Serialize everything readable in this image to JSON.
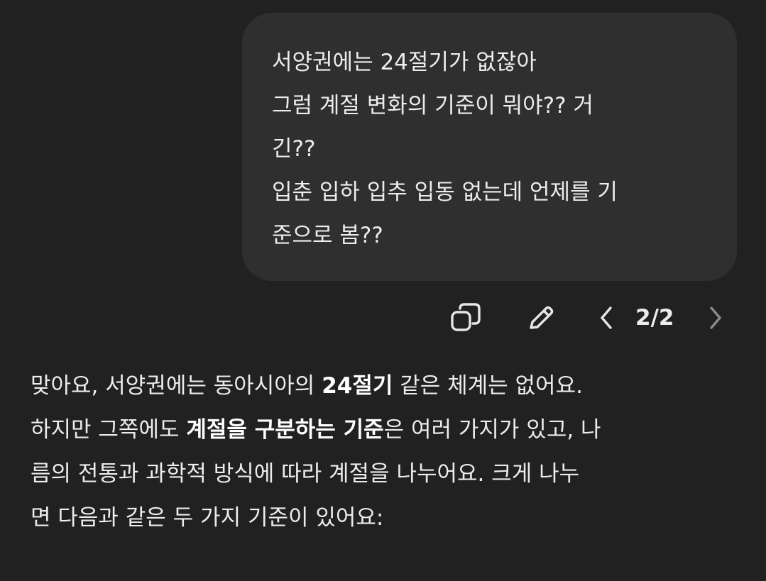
{
  "user_message": {
    "lines": [
      "서양권에는 24절기가 없잖아",
      "그럼 계절 변화의 기준이 뭐야?? 거",
      "긴??",
      "입춘 입하 입추 입동 없는데 언제를 기",
      "준으로 봄??"
    ]
  },
  "message_actions": {
    "copy_icon": "copy-icon",
    "edit_icon": "pencil-icon",
    "prev_icon": "chevron-left-icon",
    "next_icon": "chevron-right-icon",
    "pager": "2/2"
  },
  "assistant_message": {
    "line1": {
      "before": "맞아요, 서양권에는 동아시아의 ",
      "bold": "24절기",
      "after": " 같은 체계는 없어요."
    },
    "line2": {
      "before": "하지만 그쪽에도 ",
      "bold": "계절을 구분하는 기준",
      "after": "은 여러 가지가 있고, 나"
    },
    "line3": "름의 전통과 과학적 방식에 따라 계절을 나누어요. 크게 나누",
    "line4": "면 다음과 같은 두 가지 기준이 있어요:"
  },
  "colors": {
    "background": "#212121",
    "user_bubble": "#2f2f2f",
    "text": "#ececec",
    "icon": "#e6e6e6",
    "icon_disabled": "#8a8a8a"
  }
}
